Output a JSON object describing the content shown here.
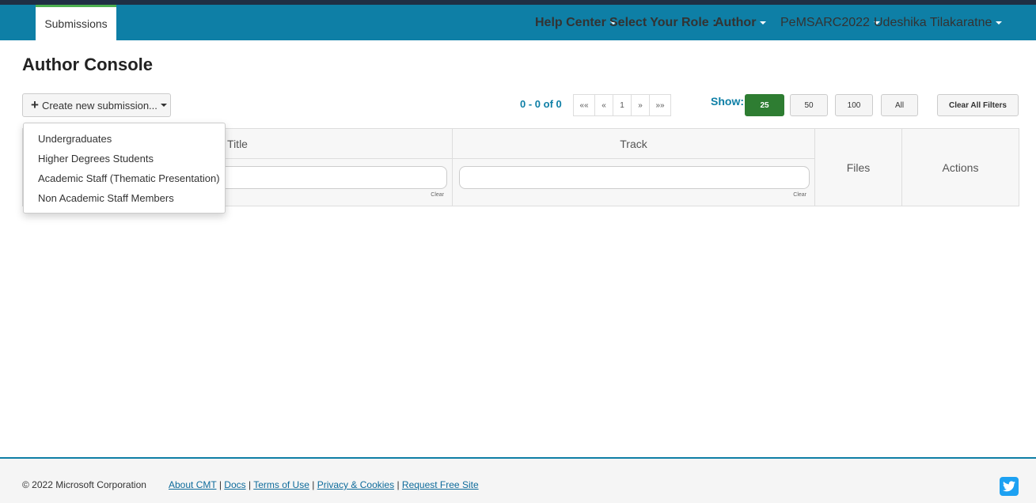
{
  "nav": {
    "tab": "Submissions",
    "help_center": "Help Center",
    "select_role_label": "Select Your Role :",
    "role": "Author",
    "conference": "PeMSARC2022",
    "user": "Udeshika Tilakaratne"
  },
  "page": {
    "title": "Author Console"
  },
  "toolbar": {
    "create_label": "Create new submission...",
    "range": "0 - 0 of 0",
    "pager": [
      "««",
      "«",
      "1",
      "»",
      "»»"
    ],
    "show_label": "Show:",
    "show_options": [
      "25",
      "50",
      "100",
      "All"
    ],
    "show_selected": "25",
    "clear_filters": "Clear All Filters"
  },
  "dropdown": {
    "items": [
      "Undergraduates",
      "Higher Degrees Students",
      "Academic Staff (Thematic Presentation)",
      "Non Academic Staff Members"
    ]
  },
  "table": {
    "columns": [
      "Title",
      "Track",
      "Files",
      "Actions"
    ],
    "clear": "Clear"
  },
  "footer": {
    "copyright": "© 2022 Microsoft Corporation",
    "links": [
      "About CMT",
      "Docs",
      "Terms of Use",
      "Privacy & Cookies",
      "Request Free Site"
    ],
    "separator": "|"
  },
  "colors": {
    "navbar": "#0e7fa6",
    "accent_green": "#2e7d32",
    "twitter": "#1da1f2"
  }
}
